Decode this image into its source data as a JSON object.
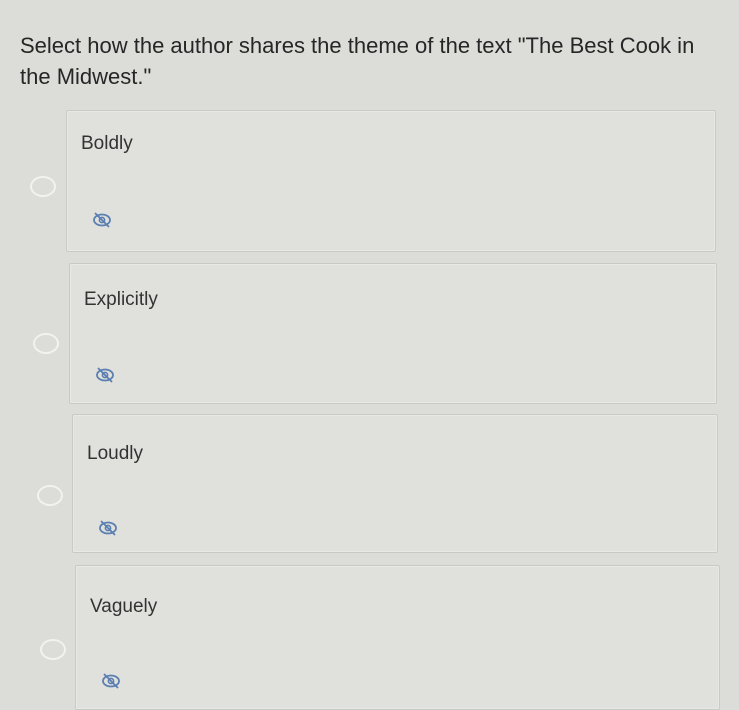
{
  "question": {
    "text": "Select how the author shares the theme of the text \"The Best Cook in the Midwest.\""
  },
  "options": [
    {
      "label": "Boldly",
      "selected": false,
      "icon": "eye-slash-icon"
    },
    {
      "label": "Explicitly",
      "selected": false,
      "icon": "eye-slash-icon"
    },
    {
      "label": "Loudly",
      "selected": false,
      "icon": "eye-slash-icon"
    },
    {
      "label": "Vaguely",
      "selected": false,
      "icon": "eye-slash-icon"
    }
  ],
  "colors": {
    "background": "#dcdcd9",
    "card": "#e0e0dd",
    "radio": "#f2f2f0",
    "icon": "#5a7fb0"
  }
}
